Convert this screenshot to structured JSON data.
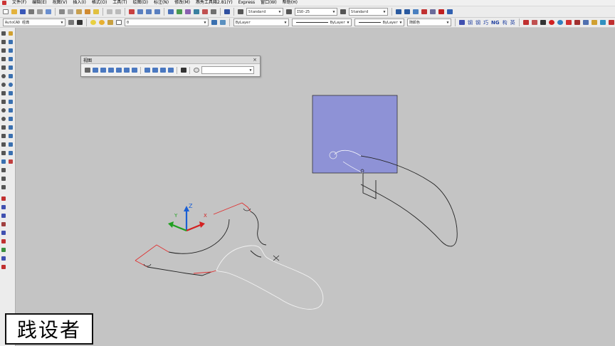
{
  "menu": [
    "文件(F)",
    "编辑(E)",
    "视图(V)",
    "插入(I)",
    "格式(O)",
    "工具(T)",
    "绘图(D)",
    "标注(N)",
    "修改(M)",
    "燕秀工具箱2.81(Y)",
    "Express",
    "窗口(W)",
    "帮助(H)"
  ],
  "toolbar1": {
    "text_style": "Standard",
    "dim_style": "ISO-25",
    "table_style": "Standard"
  },
  "toolbar2": {
    "workspace": "AutoCAD 经典",
    "layer": "0",
    "color": "ByLayer",
    "linetype": "ByLayer",
    "lineweight": "ByLayer",
    "plotstyle": "随颜色",
    "right_tools": [
      "钢",
      "钢",
      "巧",
      "NG",
      "构",
      "英"
    ]
  },
  "view_toolbar": {
    "title": "视图",
    "close_glyph": "×",
    "named_view": ""
  },
  "ucs": {
    "x_label": "X",
    "y_label": "Y",
    "z_label": "Z"
  },
  "watermark": "践设者",
  "colors": {
    "selection_fill": "#8e92d6",
    "red_edges": "#e03030",
    "white_edges": "#f2f2f2",
    "ucs_x": "#d42020",
    "ucs_y": "#20a020",
    "ucs_z": "#1a5fd4"
  }
}
